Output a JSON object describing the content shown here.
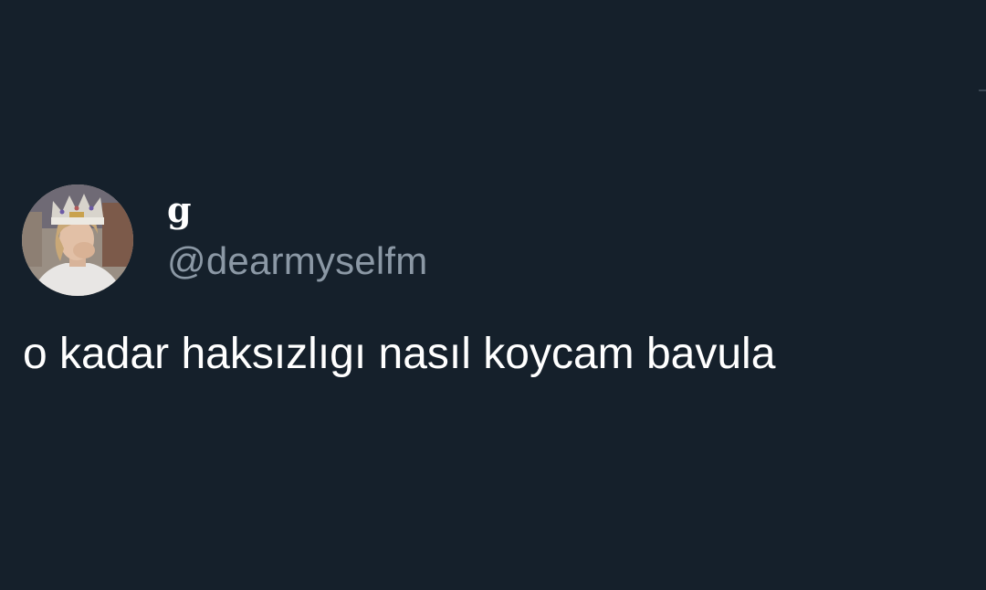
{
  "tweet": {
    "display_name": "g",
    "handle": "@dearmyselfm",
    "text": "o kadar haksızlıgı nasıl koycam bavula"
  },
  "theme": {
    "background": "#15202b",
    "text_primary": "#ffffff",
    "text_secondary": "#8b98a5"
  }
}
